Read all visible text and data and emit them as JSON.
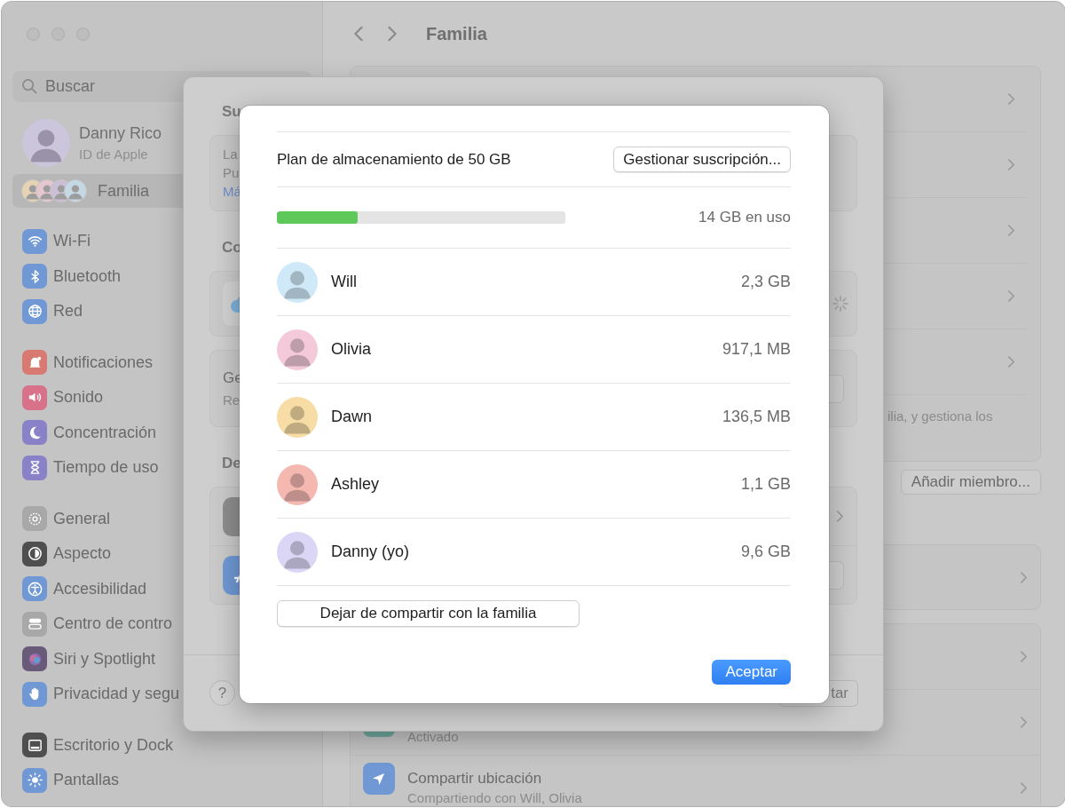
{
  "window": {
    "title": "Familia"
  },
  "sidebar": {
    "search": {
      "placeholder": "Buscar"
    },
    "profile": {
      "name": "Danny Rico",
      "subtitle": "ID de Apple",
      "color": "#cbc6dc"
    },
    "family": {
      "label": "Familia",
      "selected": true,
      "avatars": [
        {
          "color": "#e7d3b4"
        },
        {
          "color": "#e6c6cf"
        },
        {
          "color": "#cbbfd6"
        },
        {
          "color": "#c4d9e4"
        }
      ]
    },
    "groups": [
      {
        "items": [
          {
            "label": "Wi-Fi",
            "color": "#6f98d4"
          },
          {
            "label": "Bluetooth",
            "color": "#6f98d4"
          },
          {
            "label": "Red",
            "color": "#6f98d4"
          }
        ]
      },
      {
        "items": [
          {
            "label": "Notificaciones",
            "color": "#d87a72"
          },
          {
            "label": "Sonido",
            "color": "#d8728a"
          },
          {
            "label": "Concentración",
            "color": "#8a82c8"
          },
          {
            "label": "Tiempo de uso",
            "color": "#8a82c8"
          }
        ]
      },
      {
        "items": [
          {
            "label": "General",
            "color": "#a8a8a8"
          },
          {
            "label": "Aspecto",
            "color": "#4f4f4f"
          },
          {
            "label": "Accesibilidad",
            "color": "#6f98d4"
          },
          {
            "label": "Centro de contro",
            "color": "#a8a8a8"
          },
          {
            "label": "Siri y Spotlight",
            "color": "#6a5a7a"
          },
          {
            "label": "Privacidad y segu",
            "color": "#6f98d4"
          }
        ]
      },
      {
        "items": [
          {
            "label": "Escritorio y Dock",
            "color": "#4f4f4f"
          },
          {
            "label": "Pantallas",
            "color": "#6f98d4"
          }
        ]
      }
    ]
  },
  "main": {
    "description": "ilia, y gestiona los",
    "add_member_button": "Añadir miembro...",
    "status_subtitle": "Activado",
    "location": {
      "title": "Compartir ubicación",
      "subtitle": "Compartiendo con Will, Olivia"
    }
  },
  "subscription_sheet": {
    "section_1": {
      "heading": "Su",
      "lines": [
        {
          "text": "La",
          "kind": "text"
        },
        {
          "text": "Pu",
          "kind": "text"
        },
        {
          "text": "Má",
          "kind": "link"
        }
      ]
    },
    "section_2": {
      "heading": "Co"
    },
    "general_card": {
      "title": "Ge",
      "subtitle": "Re"
    },
    "section_3": {
      "heading": "De"
    },
    "help_button": "?",
    "confirm_button": "tar"
  },
  "storage_sheet": {
    "plan": "Plan de almacenamiento de 50 GB",
    "manage_button": "Gestionar suscripción...",
    "usage": {
      "level": 0.28,
      "label": "14 GB en uso"
    },
    "members": [
      {
        "name": "Will",
        "usage": "2,3 GB",
        "color": "#cfe9f8"
      },
      {
        "name": "Olivia",
        "usage": "917,1 MB",
        "color": "#f4c9da"
      },
      {
        "name": "Dawn",
        "usage": "136,5 MB",
        "color": "#f7dca6"
      },
      {
        "name": "Ashley",
        "usage": "1,1 GB",
        "color": "#f4b8b1"
      },
      {
        "name": "Danny (yo)",
        "usage": "9,6 GB",
        "color": "#dcd6f6"
      }
    ],
    "stop_sharing_button": "Dejar de compartir con la familia",
    "ok_button": "Aceptar"
  }
}
